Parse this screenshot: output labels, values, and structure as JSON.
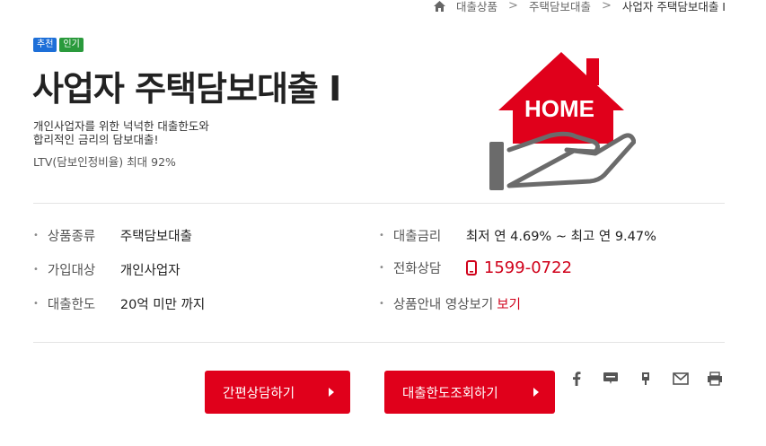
{
  "breadcrumb": {
    "items": [
      "대출상품",
      "주택담보대출",
      "사업자 주택담보대출 I"
    ]
  },
  "badges": [
    {
      "label": "추천",
      "color": "#1d6fd8"
    },
    {
      "label": "인기",
      "color": "#2a9a3c"
    }
  ],
  "product": {
    "title": "사업자 주택담보대출  I",
    "description_line1": "개인사업자를 위한 넉넉한 대출한도와",
    "description_line2": "합리적인 금리의 담보대출!",
    "ltv": "LTV(담보인정비율) 최대 92%",
    "hero_label": "HOME"
  },
  "details": {
    "left": [
      {
        "label": "상품종류",
        "value": "주택담보대출"
      },
      {
        "label": "가입대상",
        "value": "개인사업자"
      },
      {
        "label": "대출한도",
        "value": "20억 미만 까지"
      }
    ],
    "rate": {
      "label": "대출금리",
      "value": "최저 연 4.69% ~ 최고 연 9.47%"
    },
    "phone": {
      "label": "전화상담",
      "value": "1599-0722"
    },
    "video": {
      "label": "상품안내 영상보기",
      "link": "보기"
    }
  },
  "buttons": {
    "consult": "간편상담하기",
    "limit": "대출한도조회하기"
  },
  "share_icons": [
    "facebook-icon",
    "blog-icon",
    "kakao-story-icon",
    "mail-icon",
    "print-icon"
  ],
  "colors": {
    "accent": "#e0001b",
    "badge_recommend": "#1d6fd8",
    "badge_popular": "#2a9a3c"
  }
}
